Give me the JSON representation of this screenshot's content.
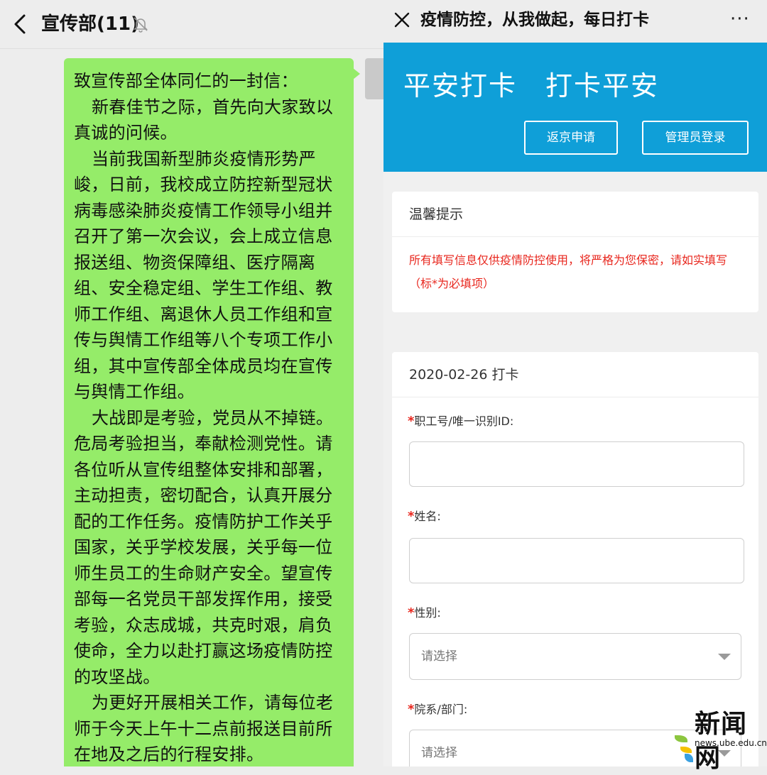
{
  "chat": {
    "title": "宣传部(11)",
    "message": [
      "致宣传部全体同仁的一封信：",
      "新春佳节之际，首先向大家致以真诚的问候。",
      "当前我国新型肺炎疫情形势严峻，日前，我校成立防控新型冠状病毒感染肺炎疫情工作领导小组并召开了第一次会议，会上成立信息报送组、物资保障组、医疗隔离组、安全稳定组、学生工作组、教师工作组、离退休人员工作组和宣传与舆情工作组等八个专项工作小组，其中宣传部全体成员均在宣传与舆情工作组。",
      "大战即是考验，党员从不掉链。危局考验担当，奉献检测党性。请各位听从宣传组整体安排和部署，主动担责，密切配合，认真开展分配的工作任务。疫情防护工作关乎国家，关乎学校发展，关乎每一位师生员工的生命财产安全。望宣传部每一名党员干部发挥作用，接受考验，众志成城，共克时艰，肩负使命，全力以赴打赢这场疫情防控的攻坚战。",
      "为更好开展相关工作，请每位老师于今天上午十二点前报送目前所在地及之后的行程安排。"
    ],
    "bubble_color": "#95ec69"
  },
  "miniprogram": {
    "dot": ".",
    "title": "疫情防控，从我做起，每日打卡",
    "more": "···",
    "banner": {
      "title": "平安打卡　打卡平安",
      "return_button": "返京申请",
      "admin_button": "管理员登录",
      "color": "#0f9fd8"
    },
    "tip": {
      "heading": "温馨提示",
      "text": "所有填写信息仅供疫情防控使用，将严格为您保密，请如实填写（标*为必填项）"
    },
    "form": {
      "heading": "2020-02-26 打卡",
      "required_mark": "*",
      "fields": [
        {
          "label": "职工号/唯一识别ID:",
          "type": "text"
        },
        {
          "label": "姓名:",
          "type": "text"
        },
        {
          "label": "性别:",
          "type": "select",
          "placeholder": "请选择"
        },
        {
          "label": "院系/部门:",
          "type": "select",
          "placeholder": "请选择"
        }
      ]
    }
  },
  "watermark": {
    "text": "新闻网",
    "url": "news.ube.edu.cn"
  },
  "icons": {
    "back": "chevron-left-icon",
    "mute": "bell-off-icon",
    "close": "close-icon",
    "more": "more-icon",
    "dropdown": "caret-down-icon"
  }
}
